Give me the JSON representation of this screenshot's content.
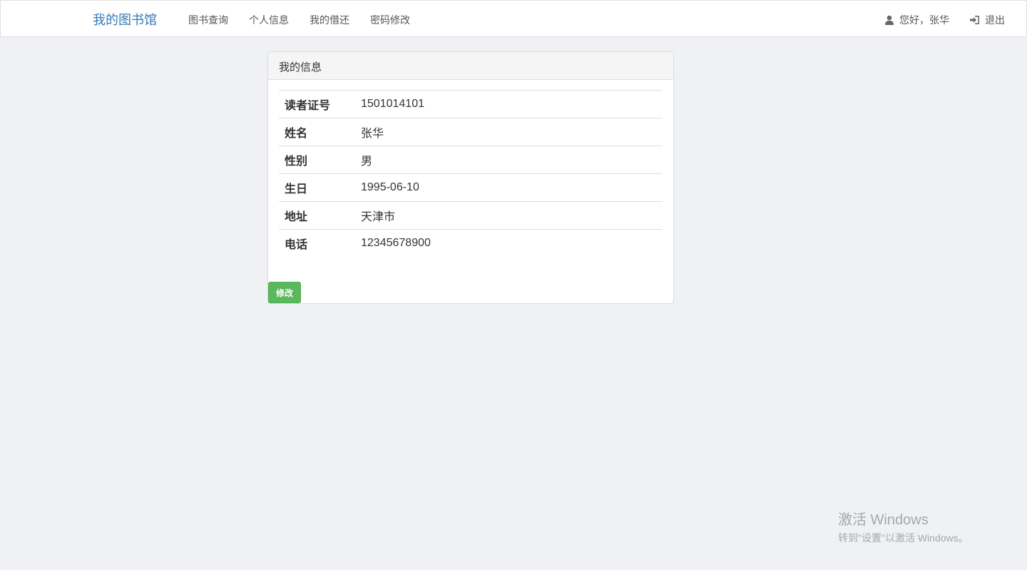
{
  "navbar": {
    "brand": "我的图书馆",
    "links": [
      "图书查询",
      "个人信息",
      "我的借还",
      "密码修改"
    ],
    "greeting": "您好，张华",
    "logout": "退出",
    "icons": {
      "user": "user-icon",
      "logout": "sign-in-icon"
    }
  },
  "panel": {
    "title": "我的信息",
    "rows": [
      {
        "label": "读者证号",
        "value": "1501014101"
      },
      {
        "label": "姓名",
        "value": "张华"
      },
      {
        "label": "性别",
        "value": "男"
      },
      {
        "label": "生日",
        "value": "1995-06-10"
      },
      {
        "label": "地址",
        "value": "天津市"
      },
      {
        "label": "电话",
        "value": "12345678900"
      }
    ],
    "edit_label": "修改"
  },
  "watermark": {
    "title": "激活 Windows",
    "subtitle": "转到\"设置\"以激活 Windows。"
  },
  "colors": {
    "brand": "#337ab7",
    "success": "#5cb85c",
    "background": "#eff1f4"
  }
}
